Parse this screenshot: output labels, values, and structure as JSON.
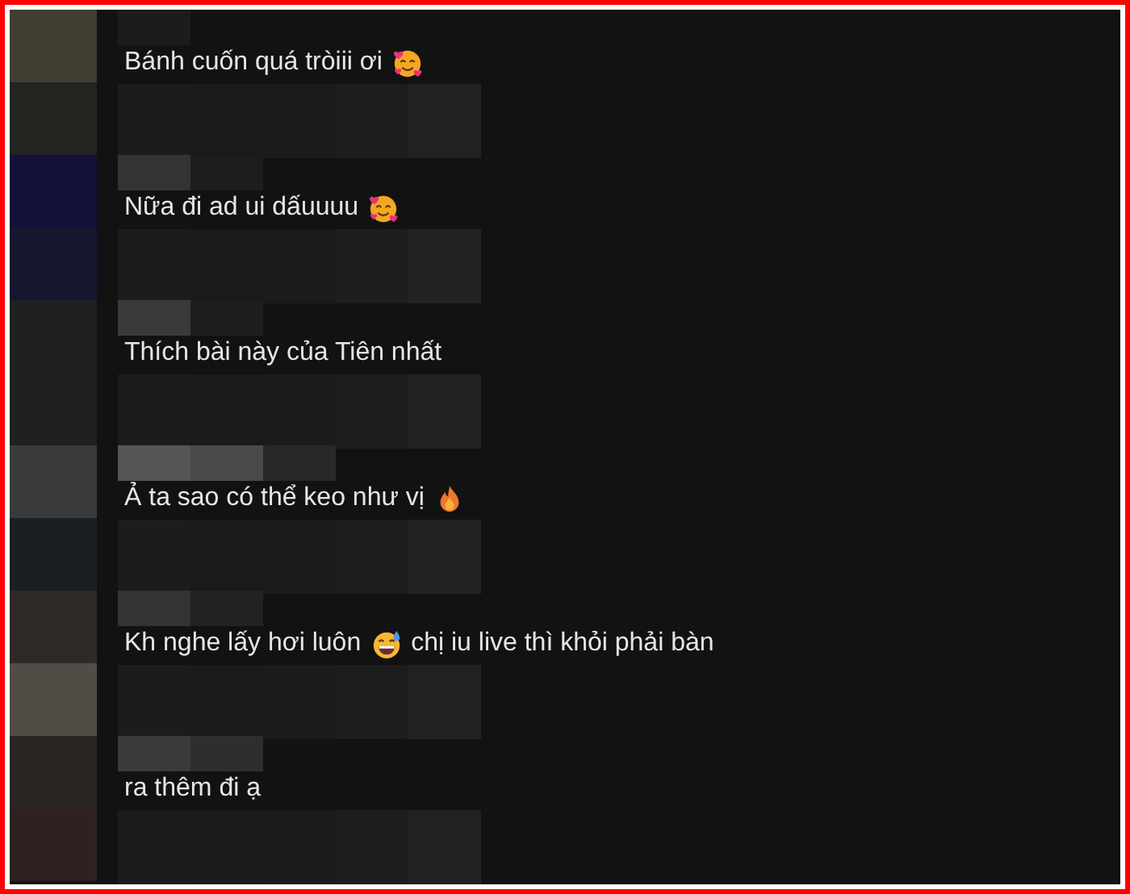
{
  "comments": [
    {
      "text": "Bánh cuốn quá tròiii ơi",
      "emoji": {
        "kind": "hearts-face"
      }
    },
    {
      "text": "Nữa đi ad ui dấuuuu",
      "emoji": {
        "kind": "hearts-face"
      }
    },
    {
      "text": "Thích bài này của Tiên nhất"
    },
    {
      "text": "Ả ta sao có thể keo như vị",
      "emoji": {
        "kind": "flame"
      }
    },
    {
      "text": "Kh nghe lấy hơi luôn",
      "emoji": {
        "kind": "sweat-grin"
      },
      "text_after": "chị iu live thì khỏi phải bàn"
    },
    {
      "text": "ra thêm đi ạ"
    }
  ]
}
